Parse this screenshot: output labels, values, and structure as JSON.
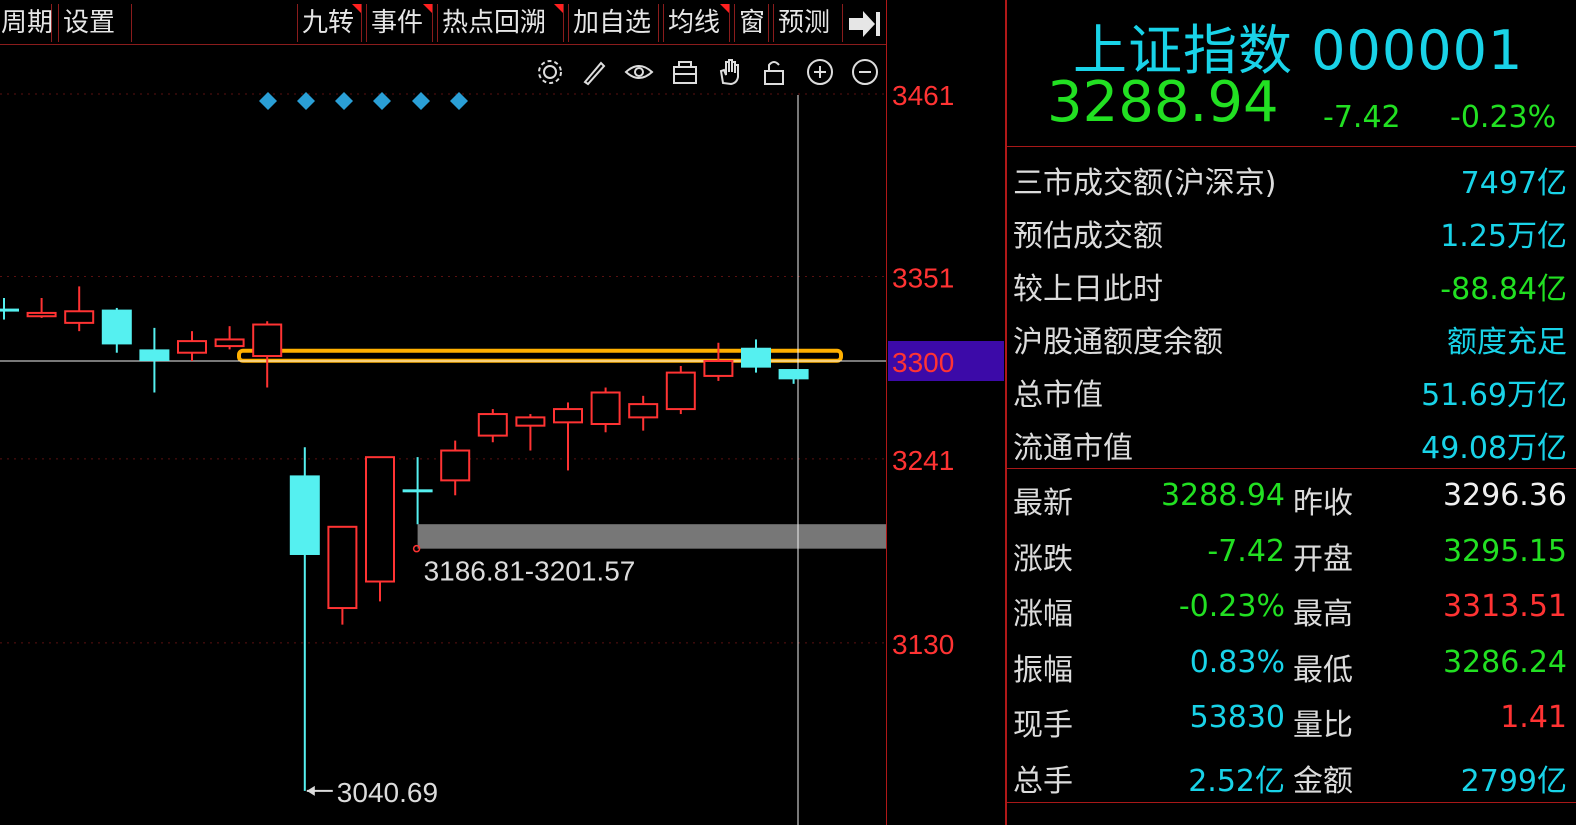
{
  "toolbar": {
    "items": [
      {
        "label": "周期",
        "mark": false
      },
      {
        "label": "设置",
        "mark": false
      },
      {
        "label": "九转",
        "mark": true
      },
      {
        "label": "事件",
        "mark": true
      },
      {
        "label": "热点回溯",
        "mark": true
      },
      {
        "label": "加自选",
        "mark": false
      },
      {
        "label": "均线",
        "mark": true
      },
      {
        "label": "窗",
        "mark": false
      },
      {
        "label": "预测",
        "mark": false
      }
    ],
    "more_icon": "arrow-right-bar-icon"
  },
  "tools": [
    "gear-icon",
    "pencil-icon",
    "eye-icon",
    "basket-icon",
    "hand-icon",
    "lock-icon",
    "zoom-in-icon",
    "zoom-out-icon"
  ],
  "colors": {
    "up": "#ff3333",
    "down": "#55f0f0",
    "green": "#22e022",
    "cyan": "#19d3e8",
    "highlight": "#ffb000",
    "gap": "#777777",
    "axis_bg": "#3c0aa8"
  },
  "stock": {
    "name": "上证指数 000001",
    "price": "3288.94",
    "change": "-7.42",
    "change_pct": "-0.23%"
  },
  "info": [
    {
      "label": "三市成交额(沪深京)",
      "value": "7497亿",
      "color": "cyan"
    },
    {
      "label": "预估成交额",
      "value": "1.25万亿",
      "color": "cyan"
    },
    {
      "label": "较上日此时",
      "value": "-88.84亿",
      "color": "green"
    },
    {
      "label": "沪股通额度余额",
      "value": "额度充足",
      "color": "cyan"
    },
    {
      "label": "总市值",
      "value": "51.69万亿",
      "color": "cyan"
    },
    {
      "label": "流通市值",
      "value": "49.08万亿",
      "color": "cyan"
    }
  ],
  "quote": [
    {
      "l1": "最新",
      "v1": "3288.94",
      "c1": "green",
      "l2": "昨收",
      "v2": "3296.36",
      "c2": "white"
    },
    {
      "l1": "涨跌",
      "v1": "-7.42",
      "c1": "green",
      "l2": "开盘",
      "v2": "3295.15",
      "c2": "green"
    },
    {
      "l1": "涨幅",
      "v1": "-0.23%",
      "c1": "green",
      "l2": "最高",
      "v2": "3313.51",
      "c2": "red"
    },
    {
      "l1": "振幅",
      "v1": "0.83%",
      "c1": "cyan",
      "l2": "最低",
      "v2": "3286.24",
      "c2": "green"
    },
    {
      "l1": "现手",
      "v1": "53830",
      "c1": "cyan",
      "l2": "量比",
      "v2": "1.41",
      "c2": "red"
    },
    {
      "l1": "总手",
      "v1": "2.52亿",
      "c1": "cyan",
      "l2": "金额",
      "v2": "2799亿",
      "c2": "cyan"
    }
  ],
  "chart_data": {
    "type": "candlestick",
    "y_ticks": [
      3461,
      3351,
      3300,
      3241,
      3130
    ],
    "current_tick": 3300,
    "candles": [
      {
        "o": 3331,
        "c": 3331,
        "h": 3338,
        "l": 3325
      },
      {
        "o": 3327,
        "c": 3329,
        "h": 3338,
        "l": 3326
      },
      {
        "o": 3323,
        "c": 3330,
        "h": 3345,
        "l": 3318
      },
      {
        "o": 3331,
        "c": 3310,
        "h": 3332,
        "l": 3305
      },
      {
        "o": 3307,
        "c": 3300,
        "h": 3320,
        "l": 3281
      },
      {
        "o": 3305,
        "c": 3312,
        "h": 3318,
        "l": 3300
      },
      {
        "o": 3309,
        "c": 3313,
        "h": 3321,
        "l": 3307
      },
      {
        "o": 3303,
        "c": 3322,
        "h": 3324,
        "l": 3284
      },
      {
        "o": 3231,
        "c": 3183,
        "h": 3248,
        "l": 3040.69
      },
      {
        "o": 3151,
        "c": 3200,
        "h": 3200,
        "l": 3141
      },
      {
        "o": 3167,
        "c": 3242,
        "h": 3242,
        "l": 3155
      },
      {
        "o": 3222,
        "c": 3222,
        "h": 3242,
        "l": 3201.57
      },
      {
        "o": 3228,
        "c": 3246,
        "h": 3252,
        "l": 3219
      },
      {
        "o": 3255,
        "c": 3268,
        "h": 3271,
        "l": 3251
      },
      {
        "o": 3261,
        "c": 3266,
        "h": 3268,
        "l": 3246
      },
      {
        "o": 3263,
        "c": 3271,
        "h": 3275,
        "l": 3234
      },
      {
        "o": 3262,
        "c": 3281,
        "h": 3284,
        "l": 3257
      },
      {
        "o": 3266,
        "c": 3274,
        "h": 3279,
        "l": 3258
      },
      {
        "o": 3271,
        "c": 3293,
        "h": 3297,
        "l": 3268
      },
      {
        "o": 3291,
        "c": 3300,
        "h": 3311,
        "l": 3288
      },
      {
        "o": 3308,
        "c": 3296,
        "h": 3313,
        "l": 3293
      },
      {
        "o": 3295.15,
        "c": 3288.94,
        "h": 3295.15,
        "l": 3286.24
      }
    ],
    "annotations": {
      "low_label": "3040.69",
      "gap_label": "3186.81-3201.57",
      "gap_low": 3186.81,
      "gap_high": 3201.57
    }
  }
}
